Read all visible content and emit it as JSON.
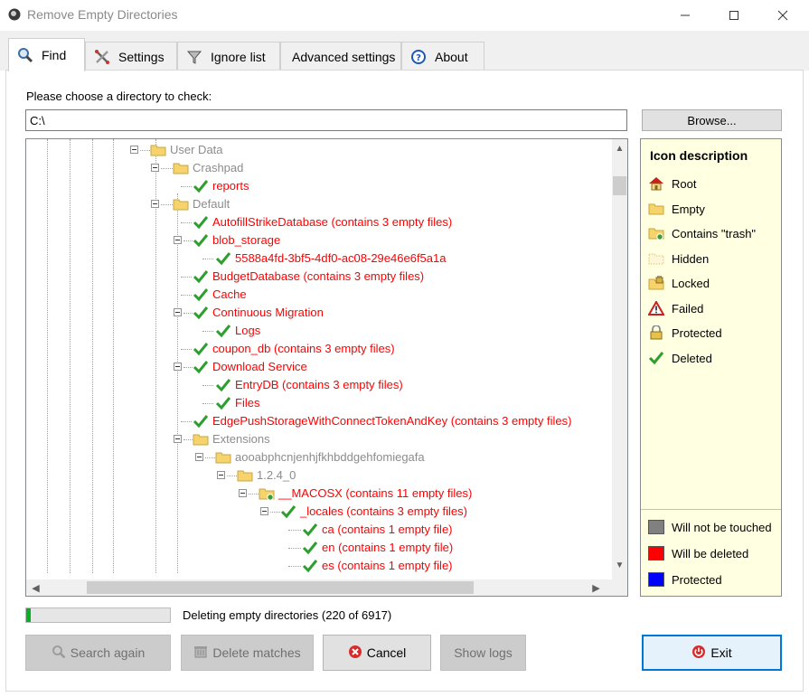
{
  "window": {
    "title": "Remove Empty Directories"
  },
  "tabs": [
    {
      "label": "Find",
      "icon": "magnifier-icon",
      "active": true
    },
    {
      "label": "Settings",
      "icon": "tools-icon"
    },
    {
      "label": "Ignore list",
      "icon": "filter-icon"
    },
    {
      "label": "Advanced settings"
    },
    {
      "label": "About",
      "icon": "help-icon"
    }
  ],
  "find": {
    "choose_label": "Please choose a directory to check:",
    "path_value": "C:\\",
    "browse_label": "Browse..."
  },
  "tree": {
    "rows": [
      {
        "label": "User Data",
        "color": "gray",
        "icon": "folder"
      },
      {
        "label": "Crashpad",
        "color": "gray",
        "icon": "folder"
      },
      {
        "label": "reports",
        "color": "red",
        "icon": "check"
      },
      {
        "label": "Default",
        "color": "gray",
        "icon": "folder"
      },
      {
        "label": "AutofillStrikeDatabase (contains 3 empty files)",
        "color": "red",
        "icon": "check"
      },
      {
        "label": "blob_storage",
        "color": "red",
        "icon": "check"
      },
      {
        "label": "5588a4fd-3bf5-4df0-ac08-29e46e6f5a1a",
        "color": "red",
        "icon": "check"
      },
      {
        "label": "BudgetDatabase (contains 3 empty files)",
        "color": "red",
        "icon": "check"
      },
      {
        "label": "Cache",
        "color": "red",
        "icon": "check"
      },
      {
        "label": "Continuous Migration",
        "color": "red",
        "icon": "check"
      },
      {
        "label": "Logs",
        "color": "red",
        "icon": "check"
      },
      {
        "label": "coupon_db (contains 3 empty files)",
        "color": "red",
        "icon": "check"
      },
      {
        "label": "Download Service",
        "color": "red",
        "icon": "check"
      },
      {
        "label": "EntryDB (contains 3 empty files)",
        "color": "red",
        "icon": "check"
      },
      {
        "label": "Files",
        "color": "red",
        "icon": "check"
      },
      {
        "label": "EdgePushStorageWithConnectTokenAndKey (contains 3 empty files)",
        "color": "red",
        "icon": "check"
      },
      {
        "label": "Extensions",
        "color": "gray",
        "icon": "folder"
      },
      {
        "label": "aooabphcnjenhjfkhbddgehfomiegafa",
        "color": "gray",
        "icon": "folder"
      },
      {
        "label": "1.2.4_0",
        "color": "gray",
        "icon": "folder"
      },
      {
        "label": "__MACOSX (contains 11 empty files)",
        "color": "red",
        "icon": "folder-trash"
      },
      {
        "label": "_locales (contains 3 empty files)",
        "color": "red",
        "icon": "check"
      },
      {
        "label": "ca (contains 1 empty file)",
        "color": "red",
        "icon": "check"
      },
      {
        "label": "en (contains 1 empty file)",
        "color": "red",
        "icon": "check"
      },
      {
        "label": "es (contains 1 empty file)",
        "color": "red",
        "icon": "check"
      }
    ]
  },
  "legend": {
    "title": "Icon description",
    "icons": [
      {
        "label": "Root",
        "icon": "root-icon"
      },
      {
        "label": "Empty",
        "icon": "empty-folder-icon"
      },
      {
        "label": "Contains \"trash\"",
        "icon": "trash-folder-icon"
      },
      {
        "label": "Hidden",
        "icon": "hidden-folder-icon"
      },
      {
        "label": "Locked",
        "icon": "locked-folder-icon"
      },
      {
        "label": "Failed",
        "icon": "warning-icon"
      },
      {
        "label": "Protected",
        "icon": "protected-lock-icon"
      },
      {
        "label": "Deleted",
        "icon": "check-icon"
      }
    ],
    "colors": [
      {
        "label": "Will not be touched",
        "color": "#808080"
      },
      {
        "label": "Will be deleted",
        "color": "#ff0000"
      },
      {
        "label": "Protected",
        "color": "#0000ff"
      }
    ]
  },
  "status": {
    "text": "Deleting empty directories (220 of 6917)",
    "progress": 0.032
  },
  "buttons": {
    "search_again": "Search again",
    "delete_matches": "Delete matches",
    "cancel": "Cancel",
    "show_logs": "Show logs",
    "exit": "Exit"
  }
}
